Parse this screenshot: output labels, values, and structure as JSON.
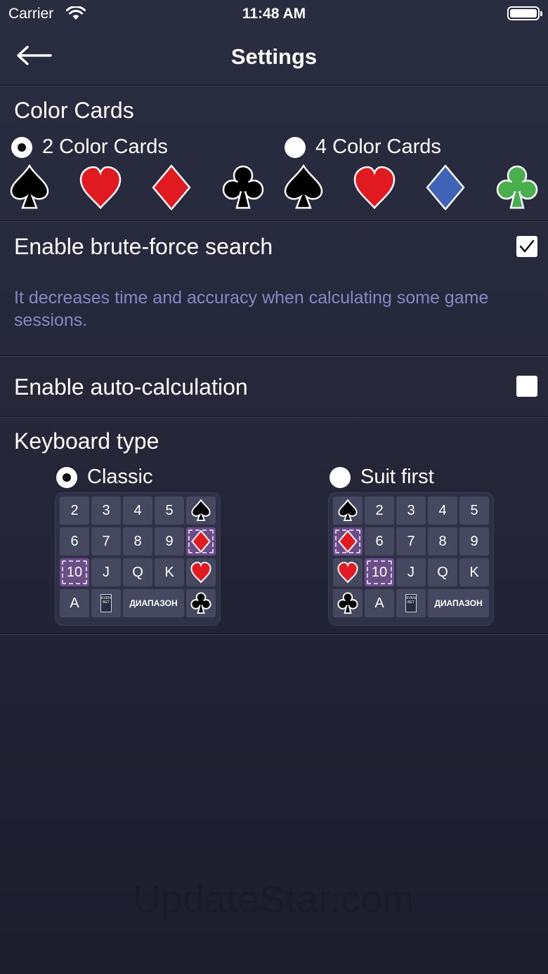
{
  "status_bar": {
    "carrier": "Carrier",
    "time": "11:48 AM"
  },
  "nav": {
    "title": "Settings",
    "back_icon": "arrow-left-icon"
  },
  "color_cards": {
    "title": "Color Cards",
    "options": [
      {
        "label": "2 Color Cards",
        "selected": true
      },
      {
        "label": "4 Color Cards",
        "selected": false
      }
    ],
    "two_color_suits": [
      "spade",
      "heart",
      "diamond",
      "club"
    ],
    "four_color_suits": [
      "spade",
      "heart",
      "diamond",
      "club"
    ],
    "colors": {
      "black": "#000000",
      "red": "#e11a22",
      "blue": "#3f63b6",
      "green": "#4aae4f"
    }
  },
  "brute_force": {
    "label": "Enable brute-force search",
    "checked": true,
    "description": "It decreases time and accuracy when calculating some game sessions."
  },
  "auto_calc": {
    "label": "Enable auto-calculation",
    "checked": false
  },
  "keyboard": {
    "title": "Keyboard type",
    "options": [
      {
        "label": "Classic",
        "selected": true
      },
      {
        "label": "Suit first",
        "selected": false
      }
    ],
    "keys": {
      "two": "2",
      "three": "3",
      "four": "4",
      "five": "5",
      "six": "6",
      "seven": "7",
      "eight": "8",
      "nine": "9",
      "ten": "10",
      "jack": "J",
      "queen": "Q",
      "king": "K",
      "ace": "A",
      "range": "ДИАПАЗОН",
      "card_icon_text": "EVEN BET"
    }
  },
  "watermark": "UpdateStar.com",
  "accent_color": "#6b4e86"
}
